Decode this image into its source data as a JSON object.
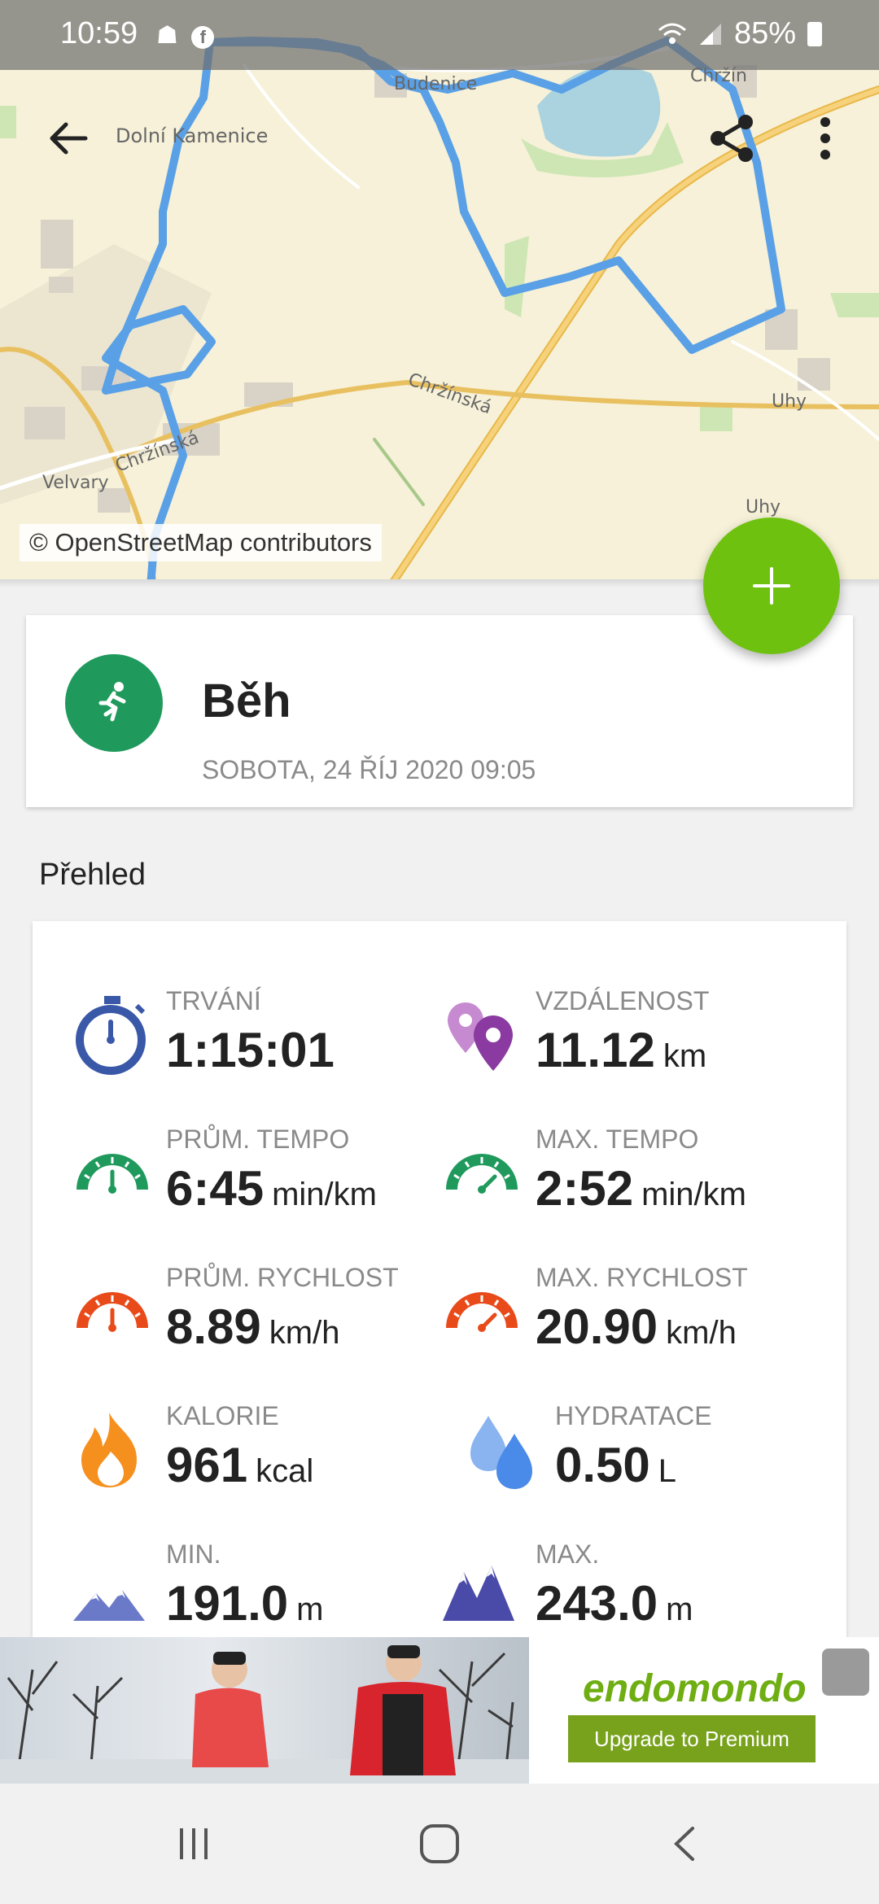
{
  "status_bar": {
    "time": "10:59",
    "battery": "85%"
  },
  "map": {
    "attribution": "© OpenStreetMap contributors",
    "place_labels": [
      "Dolní Kamenice",
      "Chržínská",
      "Velvary",
      "Uhy",
      "Uhy",
      "Chržín",
      "Budenice"
    ]
  },
  "toolbar": {
    "back_icon": "arrow-left-icon",
    "share_icon": "share-icon",
    "more_icon": "more-vert-icon"
  },
  "fab": {
    "icon": "plus-icon"
  },
  "workout": {
    "title": "Běh",
    "date": "SOBOTA, 24 ŘÍJ 2020 09:05",
    "icon": "running-icon"
  },
  "overview": {
    "section_title": "Přehled",
    "stats": [
      {
        "label": "TRVÁNÍ",
        "value": "1:15:01",
        "unit": "",
        "icon": "stopwatch-icon"
      },
      {
        "label": "VZDÁLENOST",
        "value": "11.12",
        "unit": "km",
        "icon": "distance-pins-icon"
      },
      {
        "label": "PRŮM. TEMPO",
        "value": "6:45",
        "unit": "min/km",
        "icon": "avg-pace-gauge-icon"
      },
      {
        "label": "MAX. TEMPO",
        "value": "2:52",
        "unit": "min/km",
        "icon": "max-pace-gauge-icon"
      },
      {
        "label": "PRŮM. RYCHLOST",
        "value": "8.89",
        "unit": "km/h",
        "icon": "avg-speed-gauge-icon"
      },
      {
        "label": "MAX. RYCHLOST",
        "value": "20.90",
        "unit": "km/h",
        "icon": "max-speed-gauge-icon"
      },
      {
        "label": "KALORIE",
        "value": "961",
        "unit": "kcal",
        "icon": "flame-icon"
      },
      {
        "label": "HYDRATACE",
        "value": "0.50",
        "unit": "L",
        "icon": "water-drops-icon"
      },
      {
        "label": "MIN.",
        "value": "191.0",
        "unit": "m",
        "icon": "min-altitude-mountains-icon"
      },
      {
        "label": "MAX.",
        "value": "243.0",
        "unit": "m",
        "icon": "max-altitude-mountains-icon"
      }
    ]
  },
  "ad": {
    "brand": "endomondo",
    "cta": "Upgrade to Premium"
  },
  "colors": {
    "route": "#5aa0e6",
    "fab": "#6ec20f",
    "run_avatar": "#1f9a5c",
    "stopwatch": "#3a58a8",
    "distance": "#8a3aa0",
    "pace": "#1f9a5c",
    "speed": "#e84a1a",
    "calories": "#f5901e",
    "hydration": "#4a8ae8",
    "altitude": "#4a4aa8",
    "ad_button": "#78a21c"
  }
}
